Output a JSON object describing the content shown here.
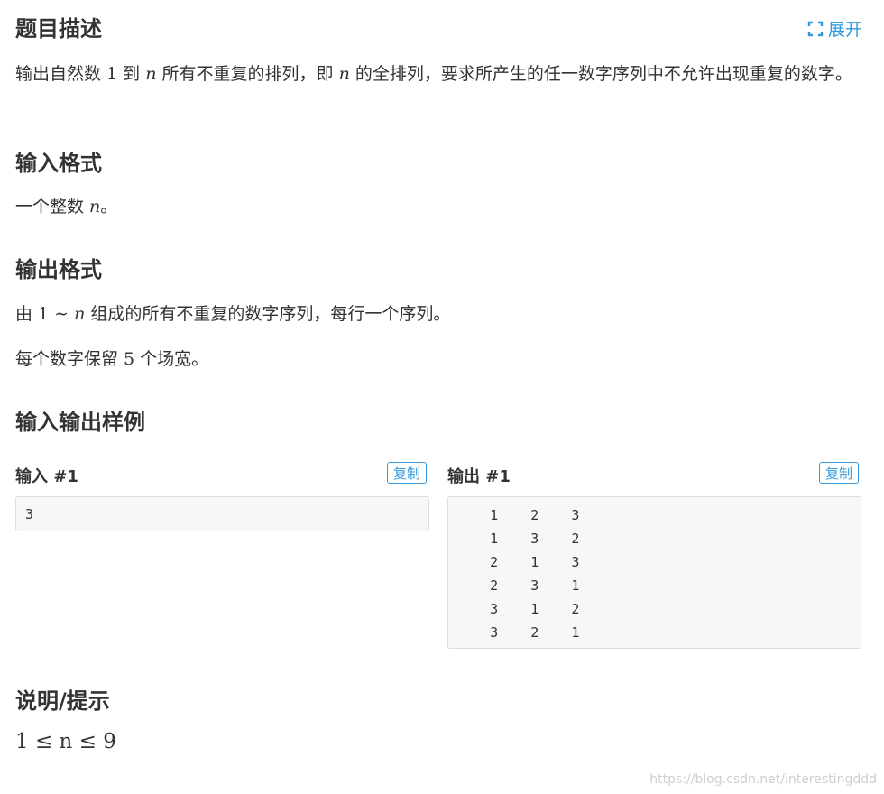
{
  "header": {
    "title": "题目描述",
    "expand_label": "展开"
  },
  "description": {
    "text_before_1": "输出自然数 ",
    "num_1": "1",
    "text_mid_1": " 到 ",
    "var_n1": "n",
    "text_mid_2": " 所有不重复的排列，即 ",
    "var_n2": "n",
    "text_end": " 的全排列，要求所产生的任一数字序列中不允许出现重复的数字。"
  },
  "input_format": {
    "title": "输入格式",
    "text_before": "一个整数 ",
    "var_n": "n",
    "text_after": "。"
  },
  "output_format": {
    "title": "输出格式",
    "line1_before": "由 ",
    "line1_num": "1",
    "line1_tilde": " ∼ ",
    "line1_var": "n",
    "line1_after": " 组成的所有不重复的数字序列，每行一个序列。",
    "line2_before": "每个数字保留 ",
    "line2_num": "5",
    "line2_after": " 个场宽。"
  },
  "samples": {
    "title": "输入输出样例",
    "input_title": "输入 #1",
    "output_title": "输出 #1",
    "copy_label": "复制",
    "input_lines": [
      "3"
    ],
    "output_lines": [
      "    1    2    3",
      "    1    3    2",
      "    2    1    3",
      "    2    3    1",
      "    3    1    2",
      "    3    2    1"
    ]
  },
  "hint": {
    "title": "说明/提示",
    "constraint": "1 ≤ n ≤ 9"
  },
  "watermark": "https://blog.csdn.net/interestingddd",
  "colors": {
    "accent": "#3498db",
    "text": "#333333",
    "code_bg": "#f7f7f7"
  }
}
